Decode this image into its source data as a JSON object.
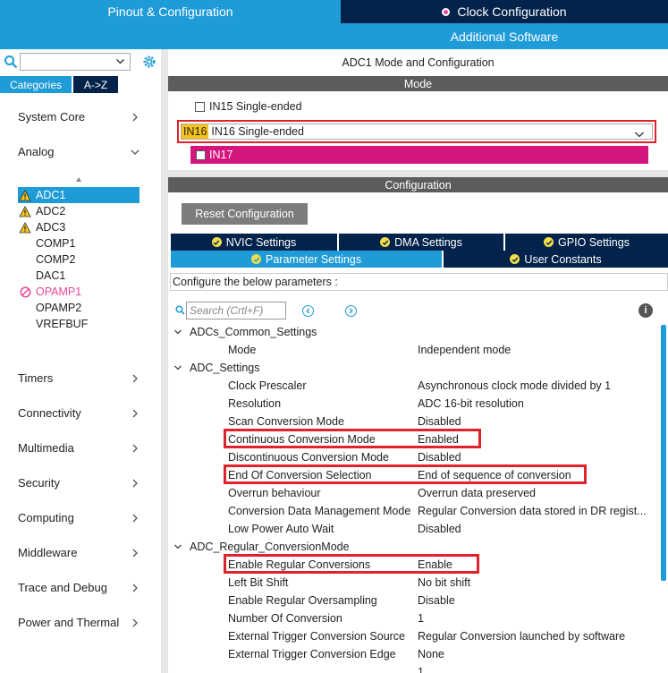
{
  "tabs": {
    "pinout": "Pinout & Configuration",
    "clock": "Clock Configuration",
    "additional": "Additional Software"
  },
  "sidebar": {
    "categories_tab": "Categories",
    "az_tab": "A->Z",
    "groups": {
      "system_core": "System Core",
      "analog": "Analog",
      "timers": "Timers",
      "connectivity": "Connectivity",
      "multimedia": "Multimedia",
      "security": "Security",
      "computing": "Computing",
      "middleware": "Middleware",
      "trace_debug": "Trace and Debug",
      "power_thermal": "Power and Thermal"
    },
    "analog_items": [
      {
        "label": "ADC1",
        "icon": "warning-icon",
        "selected": true
      },
      {
        "label": "ADC2",
        "icon": "warning-icon"
      },
      {
        "label": "ADC3",
        "icon": "warning-icon"
      },
      {
        "label": "COMP1",
        "icon": ""
      },
      {
        "label": "COMP2",
        "icon": ""
      },
      {
        "label": "DAC1",
        "icon": ""
      },
      {
        "label": "OPAMP1",
        "icon": "error-icon"
      },
      {
        "label": "OPAMP2",
        "icon": ""
      },
      {
        "label": "VREFBUF",
        "icon": ""
      }
    ]
  },
  "panel": {
    "title": "ADC1 Mode and Configuration",
    "mode_header": "Mode",
    "config_header": "Configuration",
    "in15_label": "IN15 Single-ended",
    "in16_tag": "IN16",
    "in16_value": "IN16 Single-ended",
    "in17_label": "IN17",
    "reset_button": "Reset Configuration",
    "tabs_row1": [
      "NVIC Settings",
      "DMA Settings",
      "GPIO Settings"
    ],
    "tabs_row2": [
      "Parameter Settings",
      "User Constants"
    ],
    "configure_label": "Configure the below parameters :",
    "search_placeholder": "Search (Crtl+F)",
    "info_glyph": "i"
  },
  "parameters": {
    "group1": "ADCs_Common_Settings",
    "group1_rows": [
      {
        "name": "Mode",
        "value": "Independent mode"
      }
    ],
    "group2": "ADC_Settings",
    "group2_rows": [
      {
        "name": "Clock Prescaler",
        "value": "Asynchronous clock mode divided by 1"
      },
      {
        "name": "Resolution",
        "value": "ADC 16-bit resolution"
      },
      {
        "name": "Scan Conversion Mode",
        "value": "Disabled"
      },
      {
        "name": "Continuous Conversion Mode",
        "value": "Enabled"
      },
      {
        "name": "Discontinuous Conversion Mode",
        "value": "Disabled"
      },
      {
        "name": "End Of Conversion Selection",
        "value": "End of sequence of conversion"
      },
      {
        "name": "Overrun behaviour",
        "value": "Overrun data preserved"
      },
      {
        "name": "Conversion Data Management Mode",
        "value": "Regular Conversion data stored in DR regist..."
      },
      {
        "name": "Low Power Auto Wait",
        "value": "Disabled"
      }
    ],
    "group3": "ADC_Regular_ConversionMode",
    "group3_rows": [
      {
        "name": "Enable Regular Conversions",
        "value": "Enable"
      },
      {
        "name": "Left Bit Shift",
        "value": "No bit shift"
      },
      {
        "name": "Enable Regular Oversampling",
        "value": "Disable"
      },
      {
        "name": "Number Of Conversion",
        "value": "1"
      },
      {
        "name": "External Trigger Conversion Source",
        "value": "Regular Conversion launched by software"
      },
      {
        "name": "External Trigger Conversion Edge",
        "value": "None"
      }
    ],
    "partial_row_value": "1"
  },
  "colors": {
    "tab_light": "#1f9bd8",
    "tab_dark": "#03234b",
    "highlight": "#e0222a",
    "in17_bg": "#d4157e",
    "warning": "#f7c21b"
  }
}
